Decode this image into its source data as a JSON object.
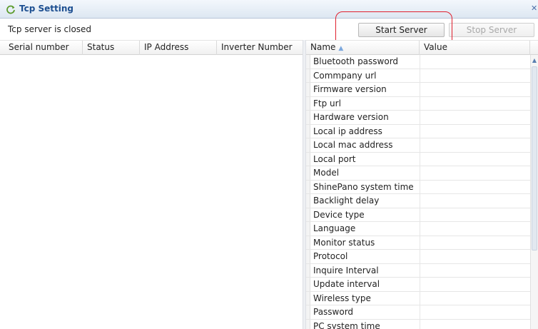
{
  "window": {
    "title": "Tcp Setting",
    "title_icon": "refresh-icon",
    "close_glyph": "✕"
  },
  "status": {
    "text": "Tcp server is closed"
  },
  "toolbar": {
    "start_label": "Start Server",
    "stop_label": "Stop Server",
    "stop_enabled": false
  },
  "inverter_table": {
    "columns": [
      "Serial number",
      "Status",
      "IP Address",
      "Inverter Number"
    ],
    "rows": []
  },
  "settings_table": {
    "columns": [
      "Name",
      "Value"
    ],
    "sort_indicator": "▲",
    "rows": [
      {
        "name": "Bluetooth password",
        "value": ""
      },
      {
        "name": "Commpany url",
        "value": ""
      },
      {
        "name": "Firmware version",
        "value": ""
      },
      {
        "name": "Ftp url",
        "value": ""
      },
      {
        "name": "Hardware version",
        "value": ""
      },
      {
        "name": "Local ip address",
        "value": ""
      },
      {
        "name": "Local mac address",
        "value": ""
      },
      {
        "name": "Local port",
        "value": ""
      },
      {
        "name": "Model",
        "value": ""
      },
      {
        "name": "ShinePano system time",
        "value": ""
      },
      {
        "name": "Backlight delay",
        "value": ""
      },
      {
        "name": "Device type",
        "value": ""
      },
      {
        "name": "Language",
        "value": ""
      },
      {
        "name": "Monitor status",
        "value": ""
      },
      {
        "name": "Protocol",
        "value": ""
      },
      {
        "name": "Inquire Interval",
        "value": ""
      },
      {
        "name": "Update interval",
        "value": ""
      },
      {
        "name": "Wireless type",
        "value": ""
      },
      {
        "name": "Password",
        "value": ""
      },
      {
        "name": "PC system time",
        "value": ""
      }
    ]
  },
  "scrollbar": {
    "up_glyph": "▲"
  },
  "colors": {
    "highlight": "#e0202e",
    "title": "#1d4f91",
    "disabled_text": "#a9a9a9"
  }
}
